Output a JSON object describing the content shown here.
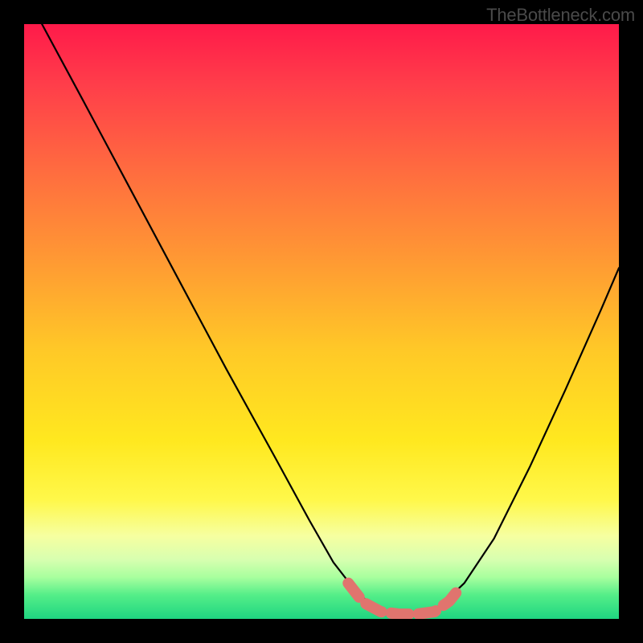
{
  "attribution": "TheBottleneck.com",
  "chart_data": {
    "type": "line",
    "title": "",
    "xlabel": "",
    "ylabel": "",
    "xlim": [
      0,
      1
    ],
    "ylim": [
      0,
      1
    ],
    "background_gradient": {
      "stops": [
        {
          "offset": 0.0,
          "color": "#ff1a4a"
        },
        {
          "offset": 0.1,
          "color": "#ff3d4a"
        },
        {
          "offset": 0.25,
          "color": "#ff6d3f"
        },
        {
          "offset": 0.4,
          "color": "#ff9a33"
        },
        {
          "offset": 0.55,
          "color": "#ffc927"
        },
        {
          "offset": 0.7,
          "color": "#ffe81f"
        },
        {
          "offset": 0.8,
          "color": "#fff84a"
        },
        {
          "offset": 0.86,
          "color": "#f6ffa0"
        },
        {
          "offset": 0.9,
          "color": "#d8ffb0"
        },
        {
          "offset": 0.93,
          "color": "#a8ff9e"
        },
        {
          "offset": 0.96,
          "color": "#54ee88"
        },
        {
          "offset": 1.0,
          "color": "#1fd581"
        }
      ]
    },
    "series": [
      {
        "name": "curve",
        "points": [
          [
            0.03,
            1.0
          ],
          [
            0.1,
            0.87
          ],
          [
            0.18,
            0.72
          ],
          [
            0.26,
            0.57
          ],
          [
            0.34,
            0.42
          ],
          [
            0.42,
            0.275
          ],
          [
            0.48,
            0.165
          ],
          [
            0.52,
            0.095
          ],
          [
            0.555,
            0.05
          ],
          [
            0.585,
            0.022
          ],
          [
            0.62,
            0.01
          ],
          [
            0.66,
            0.01
          ],
          [
            0.7,
            0.022
          ],
          [
            0.74,
            0.06
          ],
          [
            0.79,
            0.135
          ],
          [
            0.85,
            0.255
          ],
          [
            0.91,
            0.385
          ],
          [
            0.97,
            0.52
          ],
          [
            1.0,
            0.59
          ]
        ]
      },
      {
        "name": "highlight-band",
        "color": "#e0746e",
        "points": [
          [
            0.545,
            0.06
          ],
          [
            0.57,
            0.028
          ],
          [
            0.6,
            0.012
          ],
          [
            0.63,
            0.008
          ],
          [
            0.66,
            0.008
          ],
          [
            0.69,
            0.012
          ],
          [
            0.715,
            0.03
          ],
          [
            0.735,
            0.055
          ]
        ]
      }
    ]
  }
}
